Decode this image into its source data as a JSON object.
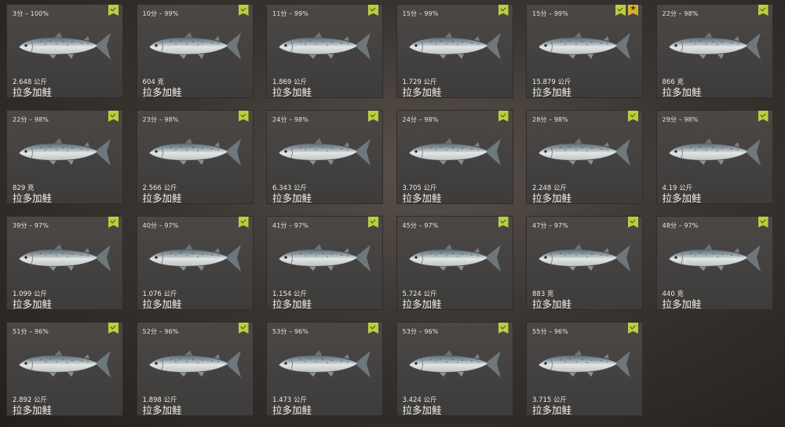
{
  "cards": [
    {
      "rank": "3分 – 100%",
      "weight": "2.648 公斤",
      "name": "拉多加鲑",
      "badges": [
        "check"
      ]
    },
    {
      "rank": "10分 – 99%",
      "weight": "604 克",
      "name": "拉多加鲑",
      "badges": [
        "check"
      ]
    },
    {
      "rank": "11分 – 99%",
      "weight": "1.869 公斤",
      "name": "拉多加鲑",
      "badges": [
        "check"
      ]
    },
    {
      "rank": "15分 – 99%",
      "weight": "1.729 公斤",
      "name": "拉多加鲑",
      "badges": [
        "check"
      ]
    },
    {
      "rank": "15分 – 99%",
      "weight": "15.879 公斤",
      "name": "拉多加鲑",
      "badges": [
        "check",
        "star"
      ]
    },
    {
      "rank": "22分 – 98%",
      "weight": "866 克",
      "name": "拉多加鲑",
      "badges": [
        "check"
      ]
    },
    {
      "rank": "22分 – 98%",
      "weight": "829 克",
      "name": "拉多加鲑",
      "badges": [
        "check"
      ]
    },
    {
      "rank": "23分 – 98%",
      "weight": "2.566 公斤",
      "name": "拉多加鲑",
      "badges": [
        "check"
      ]
    },
    {
      "rank": "24分 – 98%",
      "weight": "6.343 公斤",
      "name": "拉多加鲑",
      "badges": [
        "check"
      ]
    },
    {
      "rank": "24分 – 98%",
      "weight": "3.705 公斤",
      "name": "拉多加鲑",
      "badges": [
        "check"
      ]
    },
    {
      "rank": "28分 – 98%",
      "weight": "2.248 公斤",
      "name": "拉多加鲑",
      "badges": [
        "check"
      ]
    },
    {
      "rank": "29分 – 98%",
      "weight": "4.19 公斤",
      "name": "拉多加鲑",
      "badges": [
        "check"
      ]
    },
    {
      "rank": "39分 – 97%",
      "weight": "1.099 公斤",
      "name": "拉多加鲑",
      "badges": [
        "check"
      ]
    },
    {
      "rank": "40分 – 97%",
      "weight": "1.076 公斤",
      "name": "拉多加鲑",
      "badges": [
        "check"
      ]
    },
    {
      "rank": "41分 – 97%",
      "weight": "1.154 公斤",
      "name": "拉多加鲑",
      "badges": [
        "check"
      ]
    },
    {
      "rank": "45分 – 97%",
      "weight": "5.724 公斤",
      "name": "拉多加鲑",
      "badges": [
        "check"
      ]
    },
    {
      "rank": "47分 – 97%",
      "weight": "883 克",
      "name": "拉多加鲑",
      "badges": [
        "check"
      ]
    },
    {
      "rank": "48分 – 97%",
      "weight": "440 克",
      "name": "拉多加鲑",
      "badges": [
        "check"
      ]
    },
    {
      "rank": "51分 – 96%",
      "weight": "2.892 公斤",
      "name": "拉多加鲑",
      "badges": [
        "check"
      ]
    },
    {
      "rank": "52分 – 96%",
      "weight": "1.898 公斤",
      "name": "拉多加鲑",
      "badges": [
        "check"
      ]
    },
    {
      "rank": "53分 – 96%",
      "weight": "1.473 公斤",
      "name": "拉多加鲑",
      "badges": [
        "check"
      ]
    },
    {
      "rank": "53分 – 96%",
      "weight": "3.424 公斤",
      "name": "拉多加鲑",
      "badges": [
        "check"
      ]
    },
    {
      "rank": "55分 – 96%",
      "weight": "3.715 公斤",
      "name": "拉多加鲑",
      "badges": [
        "check"
      ]
    }
  ],
  "colors": {
    "check_badge": "#b9cf3e",
    "star_badge": "#d2b233",
    "card_bg": "#464341"
  },
  "icons": {
    "fish": "salmon-icon",
    "check": "check-badge-icon",
    "star": "star-badge-icon"
  }
}
